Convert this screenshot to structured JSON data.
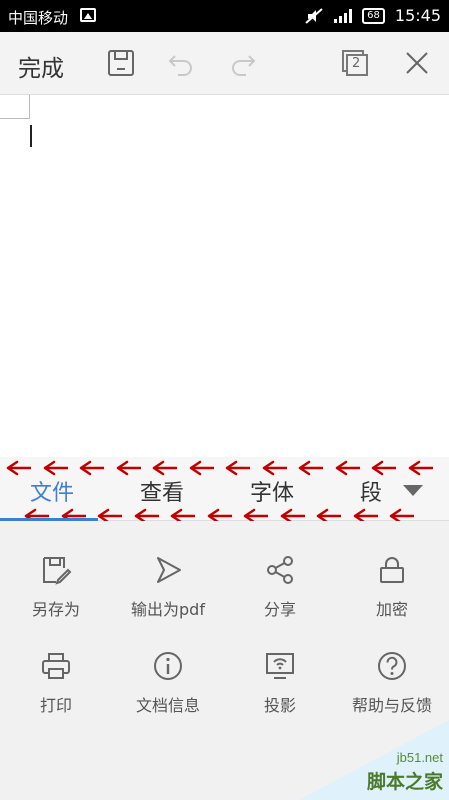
{
  "status_bar": {
    "carrier": "中国移动",
    "battery": "68",
    "time": "15:45"
  },
  "toolbar": {
    "done_label": "完成",
    "pages_count": "2"
  },
  "tabs": [
    {
      "label": "文件",
      "active": true
    },
    {
      "label": "查看",
      "active": false
    },
    {
      "label": "字体",
      "active": false
    },
    {
      "label": "段",
      "active": false
    }
  ],
  "colors": {
    "accent": "#3f7fd1",
    "annotation_arrow": "#c00000"
  },
  "file_menu": [
    {
      "label": "另存为",
      "icon": "save-as-icon"
    },
    {
      "label": "输出为pdf",
      "icon": "pdf-send-icon"
    },
    {
      "label": "分享",
      "icon": "share-icon"
    },
    {
      "label": "加密",
      "icon": "lock-icon"
    },
    {
      "label": "打印",
      "icon": "print-icon"
    },
    {
      "label": "文档信息",
      "icon": "info-icon"
    },
    {
      "label": "投影",
      "icon": "projection-icon"
    },
    {
      "label": "帮助与反馈",
      "icon": "help-icon"
    }
  ],
  "watermark": {
    "url": "jb51.net",
    "brand": "脚本之家"
  }
}
